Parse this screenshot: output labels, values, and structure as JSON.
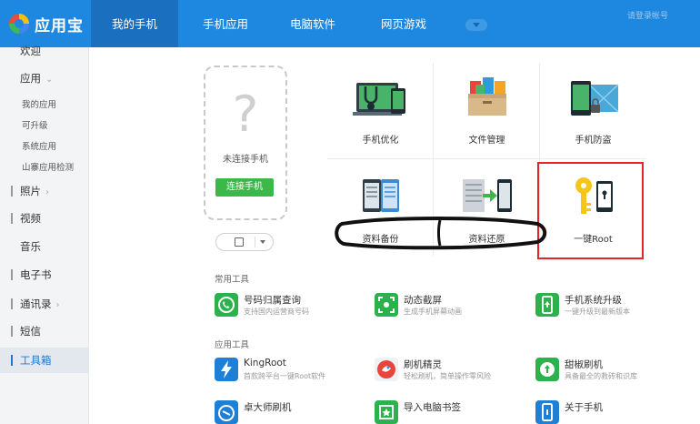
{
  "app": {
    "name": "应用宝"
  },
  "nav": {
    "tabs": [
      {
        "label": "我的手机",
        "active": true
      },
      {
        "label": "手机应用",
        "active": false
      },
      {
        "label": "电脑软件",
        "active": false
      },
      {
        "label": "网页游戏",
        "active": false
      }
    ],
    "right_text": "请登录帐号"
  },
  "sidebar": {
    "items": [
      {
        "label": "欢迎"
      },
      {
        "label": "应用"
      },
      {
        "label": "照片"
      },
      {
        "label": "视频"
      },
      {
        "label": "音乐"
      },
      {
        "label": "电子书"
      },
      {
        "label": "通讯录"
      },
      {
        "label": "短信"
      },
      {
        "label": "工具箱",
        "active": true
      }
    ],
    "app_subitems": [
      "我的应用",
      "可升级",
      "系统应用",
      "山寨应用检测"
    ]
  },
  "phone": {
    "placeholder_symbol": "?",
    "status": "未连接手机",
    "connect_label": "连接手机"
  },
  "grid": {
    "cells": [
      {
        "label": "手机优化",
        "icon": "phone-optimize-icon"
      },
      {
        "label": "文件管理",
        "icon": "file-manager-icon"
      },
      {
        "label": "手机防盗",
        "icon": "anti-theft-icon"
      },
      {
        "label": "资料备份",
        "icon": "data-backup-icon"
      },
      {
        "label": "资料还原",
        "icon": "data-restore-icon"
      },
      {
        "label": "一键Root",
        "icon": "key-root-icon"
      }
    ]
  },
  "sections": {
    "common_title": "常用工具",
    "app_title": "应用工具",
    "common_tools": [
      {
        "name": "号码归属查询",
        "desc": "支持国内运营商号码",
        "icon": "phone-lookup-icon",
        "color": "#2bb24c"
      },
      {
        "name": "动态截屏",
        "desc": "生成手机屏幕动画",
        "icon": "screen-record-icon",
        "color": "#2bb24c"
      },
      {
        "name": "手机系统升级",
        "desc": "一键升级到最新版本",
        "icon": "system-upgrade-icon",
        "color": "#2bb24c"
      }
    ],
    "app_tools": [
      {
        "name": "KingRoot",
        "desc": "首款跨平台一键Root软件",
        "icon": "kingroot-icon",
        "color": "#1e7fd6"
      },
      {
        "name": "刷机精灵",
        "desc": "轻松刷机，简单操作零风险",
        "icon": "flash-wizard-icon",
        "color": "#e8463c"
      },
      {
        "name": "甜椒刷机",
        "desc": "具备最全的救砖和识库",
        "icon": "pepper-flash-icon",
        "color": "#2bb24c"
      }
    ],
    "more_tools": [
      {
        "name": "卓大师刷机",
        "icon": "zhuo-master-icon",
        "color": "#1e7fd6"
      },
      {
        "name": "导入电脑书签",
        "icon": "bookmark-import-icon",
        "color": "#2bb24c"
      },
      {
        "name": "关于手机",
        "icon": "about-phone-icon",
        "color": "#1e7fd6"
      }
    ]
  },
  "colors": {
    "brand": "#1e88e0",
    "accent_green": "#3cb84a",
    "highlight_red": "#e0262a"
  }
}
